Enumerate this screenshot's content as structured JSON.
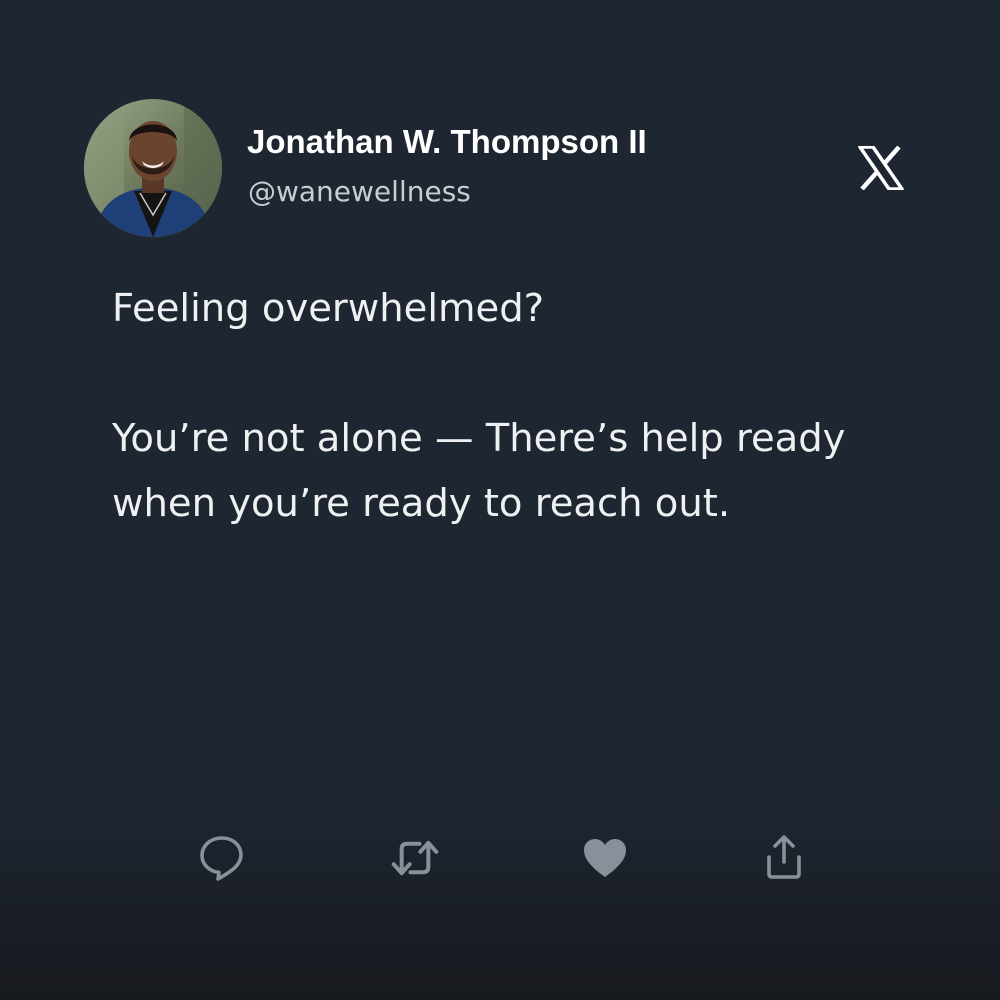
{
  "tweet": {
    "author": {
      "display_name": "Jonathan W. Thompson II",
      "handle": "@wanewellness"
    },
    "brand_icon": "x-logo-icon",
    "paragraphs": [
      "Feeling overwhelmed?",
      "You’re not alone — There’s help ready when you’re ready to reach out."
    ],
    "actions": [
      {
        "name": "reply",
        "icon": "speech-bubble-icon"
      },
      {
        "name": "retweet",
        "icon": "retweet-arrows-icon"
      },
      {
        "name": "like",
        "icon": "heart-icon"
      },
      {
        "name": "share",
        "icon": "share-upload-icon"
      }
    ]
  },
  "colors": {
    "background": "#1e2631",
    "text": "#eef0f2",
    "handle": "#c9ccd1",
    "action_icon": "#8a9099"
  }
}
